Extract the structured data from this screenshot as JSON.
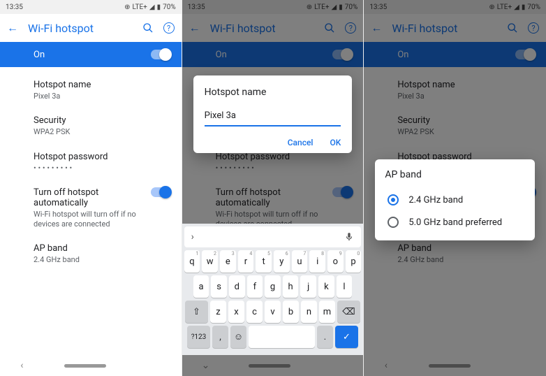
{
  "status": {
    "time": "13:35",
    "net": "LTE+",
    "battery": "70%"
  },
  "screen1": {
    "title": "Wi-Fi hotspot",
    "on_label": "On",
    "hotspot_name_label": "Hotspot name",
    "hotspot_name_value": "Pixel 3a",
    "security_label": "Security",
    "security_value": "WPA2 PSK",
    "password_label": "Hotspot password",
    "password_value": "• • • • • • • • •",
    "autooff_label": "Turn off hotspot automatically",
    "autooff_desc": "Wi-Fi hotspot will turn off if no devices are connected",
    "apband_label": "AP band",
    "apband_value": "2.4 GHz band"
  },
  "dialog_name": {
    "title": "Hotspot name",
    "value": "Pixel 3a",
    "cancel": "Cancel",
    "ok": "OK"
  },
  "dialog_apband": {
    "title": "AP band",
    "options": [
      {
        "label": "2.4 GHz band",
        "checked": true
      },
      {
        "label": "5.0 GHz band preferred",
        "checked": false
      }
    ]
  },
  "keyboard": {
    "row1": [
      "q",
      "w",
      "e",
      "r",
      "t",
      "y",
      "u",
      "i",
      "o",
      "p"
    ],
    "row1sup": [
      "1",
      "2",
      "3",
      "4",
      "5",
      "6",
      "7",
      "8",
      "9",
      "0"
    ],
    "row2": [
      "a",
      "s",
      "d",
      "f",
      "g",
      "h",
      "j",
      "k",
      "l"
    ],
    "row3": [
      "z",
      "x",
      "c",
      "v",
      "b",
      "n",
      "m"
    ],
    "symbols_label": "?123",
    "comma": ",",
    "period": "."
  }
}
